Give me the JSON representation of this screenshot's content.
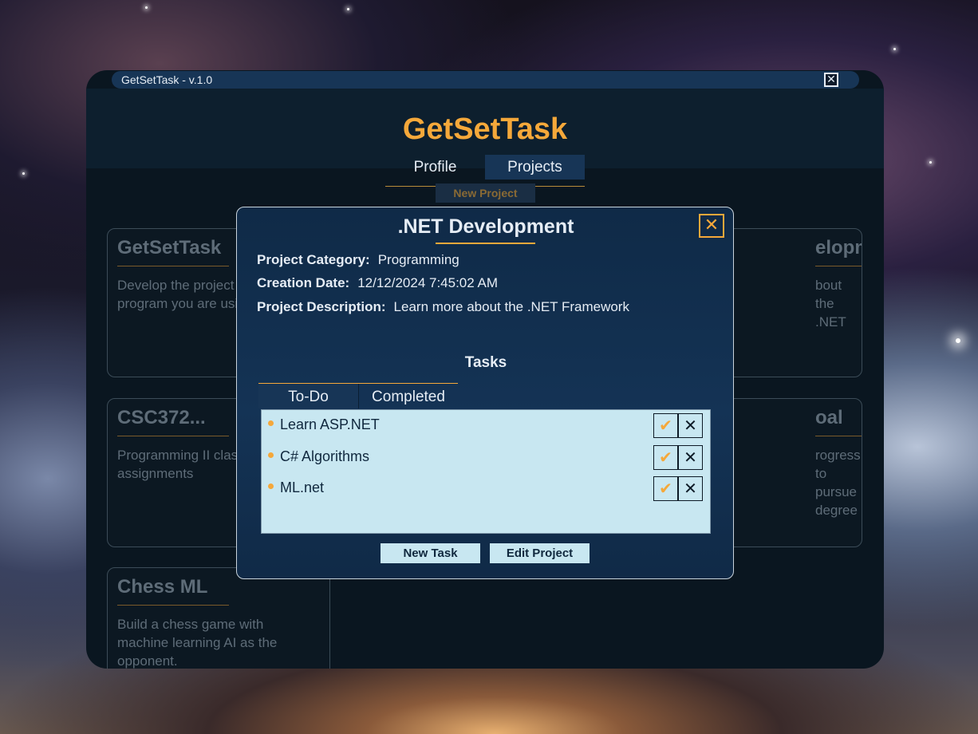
{
  "window": {
    "title": "GetSetTask - v.1.0",
    "close_glyph": "✕"
  },
  "header": {
    "app_title": "GetSetTask",
    "nav": [
      {
        "label": "Profile",
        "active": false
      },
      {
        "label": "Projects",
        "active": true
      }
    ]
  },
  "projects_page": {
    "new_project_label": "New Project",
    "cards": [
      {
        "title": "GetSetTask",
        "description": "Develop the project management program you are using."
      },
      {
        "title": ".NET Development",
        "description": "Learn more about the .NET Framework"
      },
      {
        "title": "CSC372...",
        "description": "Programming II class assignments"
      },
      {
        "title": "Goal",
        "description": "Make progress to pursue a degree"
      },
      {
        "title": "Chess ML",
        "description": "Build a chess game with machine learning AI as the opponent."
      }
    ],
    "visible_text": {
      "c2_title": "elopment",
      "c2_desc": "bout the .NET",
      "c4_title": "oal",
      "c4_desc_1": "rogress to pursue",
      "c4_desc_2": "degree"
    }
  },
  "modal": {
    "title": ".NET Development",
    "close_glyph": "✕",
    "category_label": "Project Category:",
    "category_value": "Programming",
    "date_label": "Creation Date:",
    "date_value": "12/12/2024 7:45:02 AM",
    "description_label": "Project Description:",
    "description_value": "Learn more about the .NET Framework",
    "tasks_heading": "Tasks",
    "task_tabs": [
      {
        "label": "To-Do",
        "active": true
      },
      {
        "label": "Completed",
        "active": false
      }
    ],
    "tasks": [
      {
        "name": "Learn ASP.NET"
      },
      {
        "name": "C# Algorithms"
      },
      {
        "name": "ML.net"
      }
    ],
    "complete_glyph": "✔",
    "delete_glyph": "✕",
    "new_task_label": "New Task",
    "edit_project_label": "Edit Project"
  },
  "colors": {
    "accent": "#f5a83a",
    "window_bg": "#0a1620",
    "modal_bg": "#143355",
    "list_bg": "#c8e7f1"
  }
}
